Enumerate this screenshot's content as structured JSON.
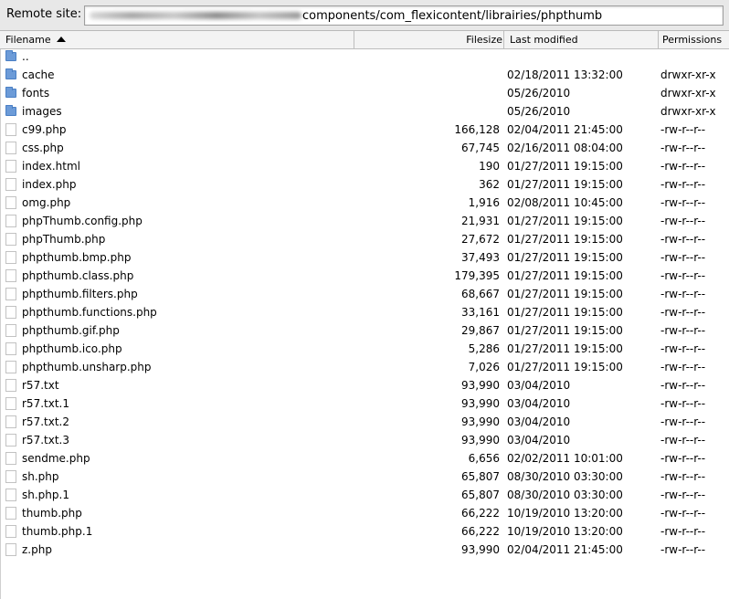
{
  "toolbar": {
    "remote_label": "Remote site:",
    "path_visible": "components/com_flexicontent/librairies/phpthumb"
  },
  "columns": {
    "filename": "Filename",
    "filesize": "Filesize",
    "modified": "Last modified",
    "permissions": "Permissions"
  },
  "rows": [
    {
      "name": "..",
      "size": "",
      "date": "",
      "perm": "",
      "type": "folder"
    },
    {
      "name": "cache",
      "size": "",
      "date": "02/18/2011 13:32:00",
      "perm": "drwxr-xr-x",
      "type": "folder"
    },
    {
      "name": "fonts",
      "size": "",
      "date": "05/26/2010",
      "perm": "drwxr-xr-x",
      "type": "folder"
    },
    {
      "name": "images",
      "size": "",
      "date": "05/26/2010",
      "perm": "drwxr-xr-x",
      "type": "folder"
    },
    {
      "name": "c99.php",
      "size": "166,128",
      "date": "02/04/2011 21:45:00",
      "perm": "-rw-r--r--",
      "type": "file"
    },
    {
      "name": "css.php",
      "size": "67,745",
      "date": "02/16/2011 08:04:00",
      "perm": "-rw-r--r--",
      "type": "file"
    },
    {
      "name": "index.html",
      "size": "190",
      "date": "01/27/2011 19:15:00",
      "perm": "-rw-r--r--",
      "type": "file"
    },
    {
      "name": "index.php",
      "size": "362",
      "date": "01/27/2011 19:15:00",
      "perm": "-rw-r--r--",
      "type": "file"
    },
    {
      "name": "omg.php",
      "size": "1,916",
      "date": "02/08/2011 10:45:00",
      "perm": "-rw-r--r--",
      "type": "file"
    },
    {
      "name": "phpThumb.config.php",
      "size": "21,931",
      "date": "01/27/2011 19:15:00",
      "perm": "-rw-r--r--",
      "type": "file"
    },
    {
      "name": "phpThumb.php",
      "size": "27,672",
      "date": "01/27/2011 19:15:00",
      "perm": "-rw-r--r--",
      "type": "file"
    },
    {
      "name": "phpthumb.bmp.php",
      "size": "37,493",
      "date": "01/27/2011 19:15:00",
      "perm": "-rw-r--r--",
      "type": "file"
    },
    {
      "name": "phpthumb.class.php",
      "size": "179,395",
      "date": "01/27/2011 19:15:00",
      "perm": "-rw-r--r--",
      "type": "file"
    },
    {
      "name": "phpthumb.filters.php",
      "size": "68,667",
      "date": "01/27/2011 19:15:00",
      "perm": "-rw-r--r--",
      "type": "file"
    },
    {
      "name": "phpthumb.functions.php",
      "size": "33,161",
      "date": "01/27/2011 19:15:00",
      "perm": "-rw-r--r--",
      "type": "file"
    },
    {
      "name": "phpthumb.gif.php",
      "size": "29,867",
      "date": "01/27/2011 19:15:00",
      "perm": "-rw-r--r--",
      "type": "file"
    },
    {
      "name": "phpthumb.ico.php",
      "size": "5,286",
      "date": "01/27/2011 19:15:00",
      "perm": "-rw-r--r--",
      "type": "file"
    },
    {
      "name": "phpthumb.unsharp.php",
      "size": "7,026",
      "date": "01/27/2011 19:15:00",
      "perm": "-rw-r--r--",
      "type": "file"
    },
    {
      "name": "r57.txt",
      "size": "93,990",
      "date": "03/04/2010",
      "perm": "-rw-r--r--",
      "type": "file"
    },
    {
      "name": "r57.txt.1",
      "size": "93,990",
      "date": "03/04/2010",
      "perm": "-rw-r--r--",
      "type": "file"
    },
    {
      "name": "r57.txt.2",
      "size": "93,990",
      "date": "03/04/2010",
      "perm": "-rw-r--r--",
      "type": "file"
    },
    {
      "name": "r57.txt.3",
      "size": "93,990",
      "date": "03/04/2010",
      "perm": "-rw-r--r--",
      "type": "file"
    },
    {
      "name": "sendme.php",
      "size": "6,656",
      "date": "02/02/2011 10:01:00",
      "perm": "-rw-r--r--",
      "type": "file"
    },
    {
      "name": "sh.php",
      "size": "65,807",
      "date": "08/30/2010 03:30:00",
      "perm": "-rw-r--r--",
      "type": "file"
    },
    {
      "name": "sh.php.1",
      "size": "65,807",
      "date": "08/30/2010 03:30:00",
      "perm": "-rw-r--r--",
      "type": "file"
    },
    {
      "name": "thumb.php",
      "size": "66,222",
      "date": "10/19/2010 13:20:00",
      "perm": "-rw-r--r--",
      "type": "file"
    },
    {
      "name": "thumb.php.1",
      "size": "66,222",
      "date": "10/19/2010 13:20:00",
      "perm": "-rw-r--r--",
      "type": "file"
    },
    {
      "name": "z.php",
      "size": "93,990",
      "date": "02/04/2011 21:45:00",
      "perm": "-rw-r--r--",
      "type": "file"
    }
  ]
}
